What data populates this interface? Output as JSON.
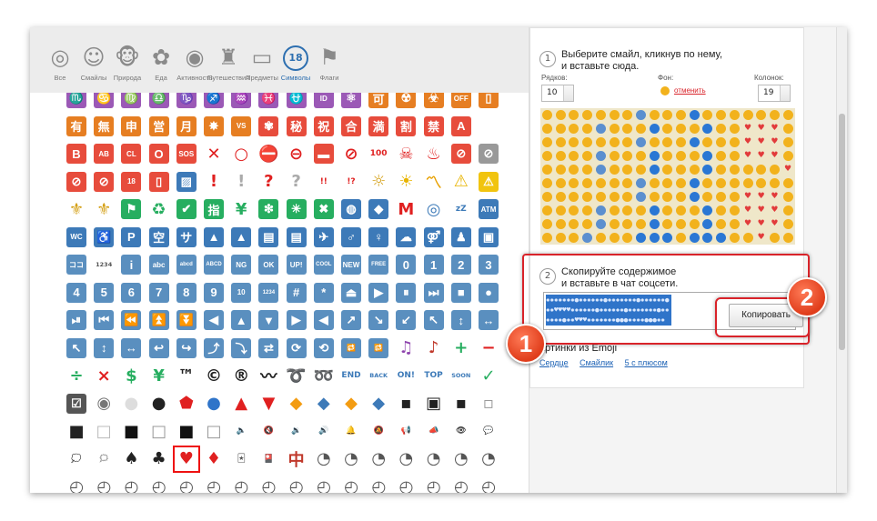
{
  "categories": [
    {
      "label": "Все",
      "icon": "spiral-icon",
      "glyph": "◎",
      "active": false
    },
    {
      "label": "Смайлы",
      "icon": "boy-face-icon",
      "glyph": "☺",
      "active": false
    },
    {
      "label": "Природа",
      "icon": "monkey-icon",
      "glyph": "🐵",
      "active": false
    },
    {
      "label": "Еда",
      "icon": "cherry-blossom-icon",
      "glyph": "✿",
      "active": false
    },
    {
      "label": "Активность",
      "icon": "target-icon",
      "glyph": "◉",
      "active": false
    },
    {
      "label": "Путешествия",
      "icon": "castle-icon",
      "glyph": "♜",
      "active": false
    },
    {
      "label": "Предметы",
      "icon": "computer-icon",
      "glyph": "▭",
      "active": false
    },
    {
      "label": "Символы",
      "icon": "symbol-18-icon",
      "glyph": "18",
      "active": true
    },
    {
      "label": "Флаги",
      "icon": "flag-icon",
      "glyph": "⚑",
      "active": false
    }
  ],
  "emoji_rows": [
    [
      {
        "t": "♏",
        "c": "#9b59b6"
      },
      {
        "t": "♋",
        "c": "#9b59b6"
      },
      {
        "t": "♍",
        "c": "#9b59b6"
      },
      {
        "t": "♎",
        "c": "#9b59b6"
      },
      {
        "t": "♑",
        "c": "#9b59b6"
      },
      {
        "t": "♐",
        "c": "#9b59b6"
      },
      {
        "t": "♒",
        "c": "#9b59b6"
      },
      {
        "t": "♓",
        "c": "#9b59b6"
      },
      {
        "t": "⛎",
        "c": "#9b59b6"
      },
      {
        "t": "ID",
        "c": "#9b59b6"
      },
      {
        "t": "⚛",
        "c": "#9b59b6"
      },
      {
        "t": "可",
        "c": "#e67e22"
      },
      {
        "t": "☢",
        "c": "#e67e22"
      },
      {
        "t": "☣",
        "c": "#e67e22"
      },
      {
        "t": "OFF",
        "c": "#e67e22"
      },
      {
        "t": "▯",
        "c": "#e67e22"
      }
    ],
    [
      {
        "t": "有",
        "c": "#e67e22"
      },
      {
        "t": "無",
        "c": "#e67e22"
      },
      {
        "t": "申",
        "c": "#e67e22"
      },
      {
        "t": "営",
        "c": "#e67e22"
      },
      {
        "t": "月",
        "c": "#e67e22"
      },
      {
        "t": "✸",
        "c": "#e67e22"
      },
      {
        "t": "VS",
        "c": "#e67e22"
      },
      {
        "t": "✾",
        "c": "#e74c3c"
      },
      {
        "t": "秘",
        "c": "#e74c3c"
      },
      {
        "t": "祝",
        "c": "#e74c3c"
      },
      {
        "t": "合",
        "c": "#e74c3c"
      },
      {
        "t": "満",
        "c": "#e74c3c"
      },
      {
        "t": "割",
        "c": "#e74c3c"
      },
      {
        "t": "禁",
        "c": "#e74c3c"
      },
      {
        "t": "A",
        "c": "#e74c3c"
      }
    ],
    [
      {
        "t": "B",
        "c": "#e74c3c"
      },
      {
        "t": "AB",
        "c": "#e74c3c"
      },
      {
        "t": "CL",
        "c": "#e74c3c"
      },
      {
        "t": "O",
        "c": "#e74c3c"
      },
      {
        "t": "SOS",
        "c": "#e74c3c"
      },
      {
        "t": "✕",
        "c": "",
        "p": "#e02020"
      },
      {
        "t": "○",
        "c": "",
        "p": "#e02020"
      },
      {
        "t": "⛔",
        "c": "",
        "p": "#e02020"
      },
      {
        "t": "⊖",
        "c": "",
        "p": "#e02020"
      },
      {
        "t": "▬",
        "c": "#e74c3c"
      },
      {
        "t": "⊘",
        "c": "",
        "p": "#e02020"
      },
      {
        "t": "100",
        "c": "",
        "p": "#e02020"
      },
      {
        "t": "☠",
        "c": "",
        "p": "#e02020"
      },
      {
        "t": "♨",
        "c": "",
        "p": "#e02020"
      },
      {
        "t": "⊘",
        "c": "#e74c3c"
      },
      {
        "t": "⊘",
        "c": "#999"
      }
    ],
    [
      {
        "t": "⊘",
        "c": "#e74c3c"
      },
      {
        "t": "⊘",
        "c": "#e74c3c"
      },
      {
        "t": "18",
        "c": "#e74c3c"
      },
      {
        "t": "▯",
        "c": "#e74c3c"
      },
      {
        "t": "▨",
        "c": "#3d7ab8"
      },
      {
        "t": "!",
        "c": "",
        "p": "#e02020"
      },
      {
        "t": "!",
        "c": "",
        "p": "#aaa"
      },
      {
        "t": "?",
        "c": "",
        "p": "#e02020"
      },
      {
        "t": "?",
        "c": "",
        "p": "#aaa"
      },
      {
        "t": "!!",
        "c": "",
        "p": "#e02020"
      },
      {
        "t": "!?",
        "c": "",
        "p": "#e02020"
      },
      {
        "t": "☼",
        "c": "",
        "p": "#d4a017"
      },
      {
        "t": "☀",
        "c": "",
        "p": "#e8b400"
      },
      {
        "t": "〽",
        "c": "",
        "p": "#e8a000"
      },
      {
        "t": "⚠",
        "c": "",
        "p": "#e8b400"
      },
      {
        "t": "⚠",
        "c": "#f1c40f"
      }
    ],
    [
      {
        "t": "⚜",
        "c": "",
        "p": "#d4a017"
      },
      {
        "t": "⚜",
        "c": "",
        "p": "#d4a017"
      },
      {
        "t": "⚑",
        "c": "#27ae60"
      },
      {
        "t": "♻",
        "c": "",
        "p": "#27ae60"
      },
      {
        "t": "✔",
        "c": "#27ae60"
      },
      {
        "t": "指",
        "c": "#27ae60"
      },
      {
        "t": "¥",
        "c": "",
        "p": "#27ae60"
      },
      {
        "t": "❇",
        "c": "#27ae60"
      },
      {
        "t": "✳",
        "c": "#27ae60"
      },
      {
        "t": "✖",
        "c": "#27ae60"
      },
      {
        "t": "◍",
        "c": "#3d7ab8"
      },
      {
        "t": "◆",
        "c": "#3d7ab8"
      },
      {
        "t": "M",
        "c": "",
        "p": "#e02020"
      },
      {
        "t": "◎",
        "c": "",
        "p": "#3d7ab8"
      },
      {
        "t": "zZ",
        "c": "",
        "p": "#3d7ab8"
      },
      {
        "t": "ATM",
        "c": "#3d7ab8"
      }
    ],
    [
      {
        "t": "WC",
        "c": "#3d7ab8"
      },
      {
        "t": "♿",
        "c": "#3d7ab8"
      },
      {
        "t": "P",
        "c": "#3d7ab8"
      },
      {
        "t": "空",
        "c": "#3d7ab8"
      },
      {
        "t": "サ",
        "c": "#3d7ab8"
      },
      {
        "t": "▲",
        "c": "#3d7ab8"
      },
      {
        "t": "▲",
        "c": "#3d7ab8"
      },
      {
        "t": "▤",
        "c": "#3d7ab8"
      },
      {
        "t": "▤",
        "c": "#3d7ab8"
      },
      {
        "t": "✈",
        "c": "#3d7ab8"
      },
      {
        "t": "♂",
        "c": "#3d7ab8"
      },
      {
        "t": "♀",
        "c": "#3d7ab8"
      },
      {
        "t": "☁",
        "c": "#3d7ab8"
      },
      {
        "t": "⚤",
        "c": "#3d7ab8"
      },
      {
        "t": "♟",
        "c": "#3d7ab8"
      },
      {
        "t": "▣",
        "c": "#3d7ab8"
      },
      {
        "t": "▁▃▅",
        "c": "#3d7ab8"
      }
    ],
    [
      {
        "t": "ココ",
        "c": "#5a8fbf"
      },
      {
        "t": "1234",
        "c": "",
        "p": "#555"
      },
      {
        "t": "i",
        "c": "#5a8fbf"
      },
      {
        "t": "abc",
        "c": "#5a8fbf"
      },
      {
        "t": "abcd",
        "c": "#5a8fbf"
      },
      {
        "t": "ABCD",
        "c": "#5a8fbf"
      },
      {
        "t": "NG",
        "c": "#5a8fbf"
      },
      {
        "t": "OK",
        "c": "#5a8fbf"
      },
      {
        "t": "UP!",
        "c": "#5a8fbf"
      },
      {
        "t": "COOL",
        "c": "#5a8fbf"
      },
      {
        "t": "NEW",
        "c": "#5a8fbf"
      },
      {
        "t": "FREE",
        "c": "#5a8fbf"
      },
      {
        "t": "0",
        "c": "#5a8fbf"
      },
      {
        "t": "1",
        "c": "#5a8fbf"
      },
      {
        "t": "2",
        "c": "#5a8fbf"
      },
      {
        "t": "3",
        "c": "#5a8fbf"
      }
    ],
    [
      {
        "t": "4",
        "c": "#5a8fbf"
      },
      {
        "t": "5",
        "c": "#5a8fbf"
      },
      {
        "t": "6",
        "c": "#5a8fbf"
      },
      {
        "t": "7",
        "c": "#5a8fbf"
      },
      {
        "t": "8",
        "c": "#5a8fbf"
      },
      {
        "t": "9",
        "c": "#5a8fbf"
      },
      {
        "t": "10",
        "c": "#5a8fbf"
      },
      {
        "t": "1234",
        "c": "#5a8fbf"
      },
      {
        "t": "#",
        "c": "#5a8fbf"
      },
      {
        "t": "*",
        "c": "#5a8fbf"
      },
      {
        "t": "⏏",
        "c": "#5a8fbf"
      },
      {
        "t": "▶",
        "c": "#5a8fbf"
      },
      {
        "t": "⏸",
        "c": "#5a8fbf"
      },
      {
        "t": "⏭",
        "c": "#5a8fbf"
      },
      {
        "t": "■",
        "c": "#5a8fbf"
      },
      {
        "t": "●",
        "c": "#5a8fbf"
      }
    ],
    [
      {
        "t": "⏯",
        "c": "#5a8fbf"
      },
      {
        "t": "⏮",
        "c": "#5a8fbf"
      },
      {
        "t": "⏪",
        "c": "#5a8fbf"
      },
      {
        "t": "⏫",
        "c": "#5a8fbf"
      },
      {
        "t": "⏬",
        "c": "#5a8fbf"
      },
      {
        "t": "◀",
        "c": "#5a8fbf"
      },
      {
        "t": "▲",
        "c": "#5a8fbf"
      },
      {
        "t": "▼",
        "c": "#5a8fbf"
      },
      {
        "t": "▶",
        "c": "#5a8fbf"
      },
      {
        "t": "◀",
        "c": "#5a8fbf"
      },
      {
        "t": "↗",
        "c": "#5a8fbf"
      },
      {
        "t": "↘",
        "c": "#5a8fbf"
      },
      {
        "t": "↙",
        "c": "#5a8fbf"
      },
      {
        "t": "↖",
        "c": "#5a8fbf"
      },
      {
        "t": "↕",
        "c": "#5a8fbf"
      },
      {
        "t": "↔",
        "c": "#5a8fbf"
      }
    ],
    [
      {
        "t": "↖",
        "c": "#5a8fbf"
      },
      {
        "t": "↕",
        "c": "#5a8fbf"
      },
      {
        "t": "↔",
        "c": "#5a8fbf"
      },
      {
        "t": "↩",
        "c": "#5a8fbf"
      },
      {
        "t": "↪",
        "c": "#5a8fbf"
      },
      {
        "t": "⤴",
        "c": "#5a8fbf"
      },
      {
        "t": "⤵",
        "c": "#5a8fbf"
      },
      {
        "t": "⇄",
        "c": "#5a8fbf"
      },
      {
        "t": "⟳",
        "c": "#5a8fbf"
      },
      {
        "t": "⟲",
        "c": "#5a8fbf"
      },
      {
        "t": "🔁",
        "c": "#5a8fbf"
      },
      {
        "t": "🔂",
        "c": "#5a8fbf"
      },
      {
        "t": "♫",
        "c": "",
        "p": "#8e44ad"
      },
      {
        "t": "♪",
        "c": "",
        "p": "#c0392b"
      },
      {
        "t": "+",
        "c": "",
        "p": "#27ae60"
      },
      {
        "t": "−",
        "c": "",
        "p": "#e02020"
      }
    ],
    [
      {
        "t": "÷",
        "c": "",
        "p": "#27ae60"
      },
      {
        "t": "×",
        "c": "",
        "p": "#e02020"
      },
      {
        "t": "$",
        "c": "",
        "p": "#27ae60"
      },
      {
        "t": "¥",
        "c": "",
        "p": "#27ae60"
      },
      {
        "t": "™",
        "c": "",
        "p": "#222"
      },
      {
        "t": "©",
        "c": "",
        "p": "#222"
      },
      {
        "t": "®",
        "c": "",
        "p": "#222"
      },
      {
        "t": "〰",
        "c": "",
        "p": "#222"
      },
      {
        "t": "➰",
        "c": "",
        "p": "#3d7ab8"
      },
      {
        "t": "➿",
        "c": "",
        "p": "#3d7ab8"
      },
      {
        "t": "END",
        "c": "",
        "p": "#3d7ab8"
      },
      {
        "t": "BACK",
        "c": "",
        "p": "#3d7ab8"
      },
      {
        "t": "ON!",
        "c": "",
        "p": "#3d7ab8"
      },
      {
        "t": "TOP",
        "c": "",
        "p": "#3d7ab8"
      },
      {
        "t": "SOON",
        "c": "",
        "p": "#3d7ab8"
      },
      {
        "t": "✓",
        "c": "",
        "p": "#27ae60"
      }
    ],
    [
      {
        "t": "☑",
        "c": "#555"
      },
      {
        "t": "◉",
        "c": "",
        "p": "#777"
      },
      {
        "t": "●",
        "c": "",
        "p": "#ddd"
      },
      {
        "t": "●",
        "c": "",
        "p": "#222"
      },
      {
        "t": "⬟",
        "c": "",
        "p": "#e02020"
      },
      {
        "t": "●",
        "c": "",
        "p": "#2f74c9"
      },
      {
        "t": "▲",
        "c": "",
        "p": "#e02020"
      },
      {
        "t": "▼",
        "c": "",
        "p": "#e02020"
      },
      {
        "t": "◆",
        "c": "",
        "p": "#f39c12"
      },
      {
        "t": "◆",
        "c": "",
        "p": "#3d7ab8"
      },
      {
        "t": "◆",
        "c": "",
        "p": "#f39c12"
      },
      {
        "t": "◆",
        "c": "",
        "p": "#3d7ab8"
      },
      {
        "t": "▪",
        "c": "",
        "p": "#222"
      },
      {
        "t": "▣",
        "c": "",
        "p": "#222"
      },
      {
        "t": "▪",
        "c": "",
        "p": "#222"
      },
      {
        "t": "▫",
        "c": "",
        "p": "#999"
      }
    ],
    [
      {
        "t": "■",
        "c": "",
        "p": "#222"
      },
      {
        "t": "□",
        "c": "",
        "p": "#bbb"
      },
      {
        "t": "■",
        "c": "",
        "p": "#111"
      },
      {
        "t": "□",
        "c": "",
        "p": "#999"
      },
      {
        "t": "■",
        "c": "",
        "p": "#111"
      },
      {
        "t": "□",
        "c": "",
        "p": "#999"
      },
      {
        "t": "🔈",
        "c": "",
        "p": "#888"
      },
      {
        "t": "🔇",
        "c": "",
        "p": "#888"
      },
      {
        "t": "🔉",
        "c": "",
        "p": "#888"
      },
      {
        "t": "🔊",
        "c": "",
        "p": "#888"
      },
      {
        "t": "🔔",
        "c": "",
        "p": "#d4a017"
      },
      {
        "t": "🔕",
        "c": "",
        "p": "#d4a017"
      },
      {
        "t": "📢",
        "c": "",
        "p": "#d4a017"
      },
      {
        "t": "📣",
        "c": "",
        "p": "#d4a017"
      },
      {
        "t": "👁",
        "c": "",
        "p": "#444"
      },
      {
        "t": "💬",
        "c": "",
        "p": "#5a8fbf"
      }
    ],
    [
      {
        "t": "💭",
        "c": "",
        "p": "#999"
      },
      {
        "t": "🗯",
        "c": "",
        "p": "#999"
      },
      {
        "t": "♠",
        "c": "",
        "p": "#222"
      },
      {
        "t": "♣",
        "c": "",
        "p": "#222"
      },
      {
        "t": "♥",
        "c": "",
        "p": "#e02020",
        "sel": true
      },
      {
        "t": "♦",
        "c": "",
        "p": "#e02020"
      },
      {
        "t": "🃏",
        "c": "",
        "p": "#555"
      },
      {
        "t": "🎴",
        "c": "",
        "p": "#222"
      },
      {
        "t": "中",
        "c": "",
        "p": "#c0392b"
      },
      {
        "t": "◔",
        "c": "",
        "p": "#555"
      },
      {
        "t": "◔",
        "c": "",
        "p": "#555"
      },
      {
        "t": "◔",
        "c": "",
        "p": "#555"
      },
      {
        "t": "◔",
        "c": "",
        "p": "#555"
      },
      {
        "t": "◔",
        "c": "",
        "p": "#555"
      },
      {
        "t": "◔",
        "c": "",
        "p": "#555"
      },
      {
        "t": "◔",
        "c": "",
        "p": "#555"
      }
    ],
    [
      {
        "t": "◴",
        "c": "",
        "p": "#555"
      },
      {
        "t": "◴",
        "c": "",
        "p": "#555"
      },
      {
        "t": "◴",
        "c": "",
        "p": "#555"
      },
      {
        "t": "◴",
        "c": "",
        "p": "#555"
      },
      {
        "t": "◴",
        "c": "",
        "p": "#555"
      },
      {
        "t": "◴",
        "c": "",
        "p": "#555"
      },
      {
        "t": "◴",
        "c": "",
        "p": "#555"
      },
      {
        "t": "◴",
        "c": "",
        "p": "#555"
      },
      {
        "t": "◴",
        "c": "",
        "p": "#555"
      },
      {
        "t": "◴",
        "c": "",
        "p": "#555"
      },
      {
        "t": "◴",
        "c": "",
        "p": "#555"
      },
      {
        "t": "◴",
        "c": "",
        "p": "#555"
      },
      {
        "t": "◴",
        "c": "",
        "p": "#555"
      },
      {
        "t": "◴",
        "c": "",
        "p": "#555"
      },
      {
        "t": "◴",
        "c": "",
        "p": "#555"
      },
      {
        "t": "◴",
        "c": "",
        "p": "#555"
      }
    ]
  ],
  "step1": {
    "num": "1",
    "line1": "Выберите смайл, кликнув по нему,",
    "line2": "и вставьте сюда."
  },
  "rows_label": "Рядков:",
  "rows_value": "10",
  "bg_label": "Фон:",
  "bg_cancel": "отменить",
  "cols_label": "Колонок:",
  "cols_value": "19",
  "step2": {
    "num": "2",
    "line1": "Скопируйте содержимое",
    "line2": "и вставьте в чат соцсети."
  },
  "selected_text": "✹✹✹✹✹✹✹●✹✹✹✹✹✹●✹✹✹✹✹✹✹●✹✹✹✹✹✹●✹✹♥♥♥♥✹✹✹✹✹✹●✹✹✹✹✹✹●✹✹✹✹✹✹✹●✹✹✹✹✹✹●✹✹♥♥♥✹✹✹✹✹✹✹●●●✹✹✹✹●●●✹✹",
  "copy_button": "Копировать",
  "pictures_title": "артинки из Emoji",
  "links": [
    "Сердце",
    "Смайлик",
    "5 с плюсом"
  ],
  "badges": [
    "1",
    "2"
  ],
  "smiley_grid": {
    "cols": 19,
    "rows": 10,
    "pattern": [
      "sssssssgsssbsssssss",
      "ssssgsssbsssbsshhhs",
      "sssssssgsssbssshhhs",
      "ssssgsssbsssbsshhhs",
      "ssssgsssbsssbsssssh",
      "sssssssgsssbsssssss",
      "sssssssgsssbssshhhs",
      "ssssgsssbsssbsshhhs",
      "ssssgsssbsssbsshhhs",
      "sssgsssbbbsbbbsshss"
    ]
  },
  "colors": {
    "accent": "#2d6fb0",
    "callout": "#d9232a",
    "badge": "#e03d1b",
    "selection": "#2f74c9",
    "sun": "#f2b21c",
    "globe": "#5b8fcf",
    "heart": "#e23b3b",
    "ball": "#2a77d4"
  }
}
